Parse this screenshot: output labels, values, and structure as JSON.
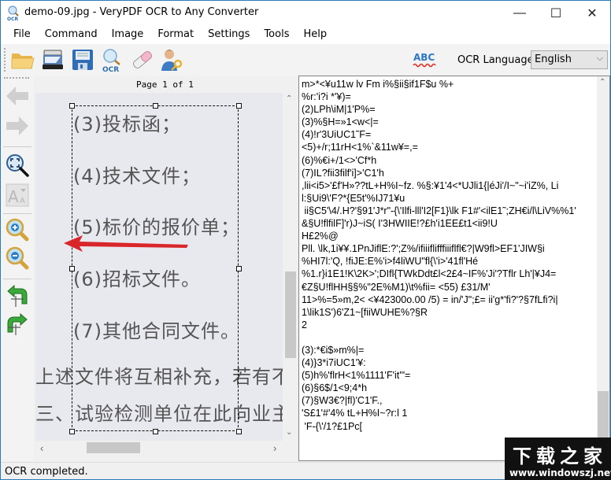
{
  "window": {
    "title": "demo-09.jpg - VeryPDF OCR to Any Converter",
    "controls": {
      "minimize": "—",
      "maximize": "☐",
      "close": "✕"
    }
  },
  "menu": {
    "items": [
      "File",
      "Command",
      "Image",
      "Format",
      "Settings",
      "Tools",
      "Help"
    ]
  },
  "toolbar": {
    "icons": [
      "open-folder-icon",
      "scanner-icon",
      "save-icon",
      "ocr-icon",
      "eraser-icon",
      "user-key-icon"
    ],
    "ocr_language_label": "OCR Language",
    "ocr_language_value": "English",
    "spellcheck_icon_text": "ABC"
  },
  "left_toolbar": {
    "icons": [
      "back-arrow-icon",
      "forward-arrow-icon",
      "fit-zoom-icon",
      "font-size-icon",
      "zoom-in-icon",
      "zoom-out-icon",
      "rotate-left-icon",
      "rotate-right-icon"
    ]
  },
  "viewer": {
    "page_label": "Page 1 of 1",
    "document_lines": [
      "(3)投标函；",
      "(4)技术文件；",
      "(5)标价的报价单；",
      "(6)招标文件。",
      "(7)其他合同文件。",
      "上述文件将互相补充，若有不",
      "三、试验检测单位在此向业主"
    ]
  },
  "ocr_output": {
    "lines": [
      "m>*<¥u11w lv Fm i%§ii§if1F$u %+",
      "%r:'i?i *'¥)=",
      "(2)LPh\\iM|1'P%=",
      "(3)%§H=»1<w<|=",
      "(4)!r'3UiUC1˜F=",
      "<5)+/r;11rH<1%`&11w¥=,=",
      "(6)%€i+/1<>'Cf*h",
      "(7)IL?fii3filf'i]>'C1'h",
      ",lii<i5>'£f'H»??tL+H%I~fz. %§:¥1'4<*UJli1{|éJi'/I~\"~i'iZ%, Li",
      "l:§Ui9\\'F?*{E5t'%IJ71¥u",
      " ii§C5'\\4/.H?'§91'J*r\"-{\\'Ilfi-lll'I2[F1}\\lk F1#'<ilE1˜;ZH€i/l\\LiV%%1'",
      "&§U!flfilF]'r)J~iS( I'3HWIIE!?£h'i1EE£t1<ii9!U",
      "H£2%@",
      "Pll. \\lk,1i¥¥.1PnJiflE:?';Z%/ifiiiflifffiiiflfl€?|W9fl>EF1'JIW§i",
      "%HI7l:'Q, !fiJE:E%'i>f4liWU\"fl{\\'i>'41fl'Hé",
      "%1.r}i1E1!K\\2K>';DIfl{TWkDdt£l<2£4~IF%'Ji'?Tflr Lh'|¥J4=",
      "€Z§U!flHH§§%\"2E%M1)\\t%fii= <55) £31/M'",
      "11>%=5»m,2< <¥42300o.00 /5) = in/'J\";£= ii'g*'fi?'?§7fLfi?i|",
      "1\\lik1S')6'Z1~[fiiWUHE%?§R",
      "2",
      "",
      "(3):*€i$»m%|=",
      "(4)}3*i7iUC1'¥:",
      "(5)h%'flrH<1%1111'F'it'\"=",
      "(6)§6$/1<9;4*h",
      "(7)§W3€?|fl)'C1'F.,",
      "'S£1'#'4% tL+H%I~?r:l 1",
      " 'F-{\\'/1?£1Pc["
    ]
  },
  "status": {
    "text": "OCR completed."
  },
  "watermark": {
    "chinese": "下载之家",
    "url": "www.windowszj.net"
  }
}
